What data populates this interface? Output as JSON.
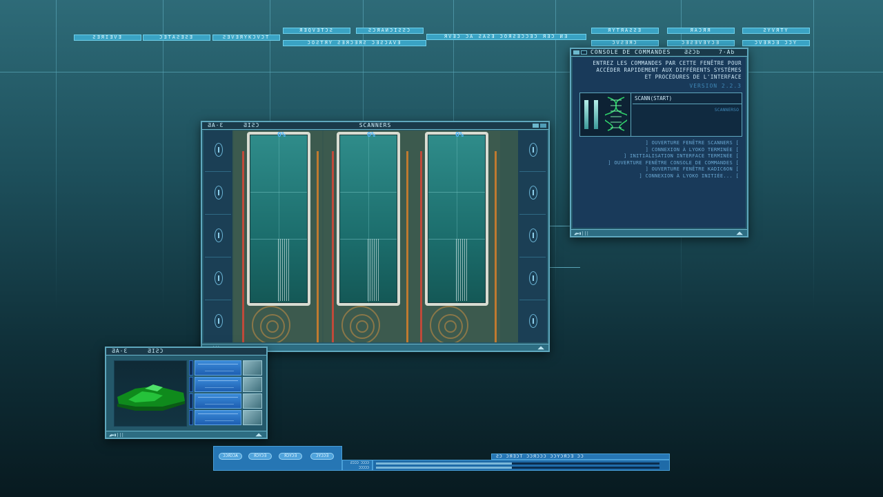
{
  "top_menu": {
    "row1": [
      {
        "label": "ƧƎЯIƎVƎ"
      },
      {
        "label": "ƆƎTAƧƎƧƎ"
      },
      {
        "label": "ƧƎVƎЯYKƆVƆT"
      },
      {
        "label": "ЯƎQVƎTƆƧ"
      },
      {
        "label": "ƧƆЯAИƆIƧƧƆ"
      },
      {
        "label": "ЯVƎƆ ƆA ƧAƧƎ ƆOЯƧƎƆƆƎƆ ЯƎƆ ИƎ"
      },
      {
        "label": "ЯYTЯAƧƧƎ"
      },
      {
        "label": "ЯAƆЯЯ"
      },
      {
        "label": "ƧYVЯTY"
      }
    ],
    "row2": [
      {
        "label": "ƆOƧTЯY  ƧƎЯƆƎЯƧ  ƆƎƧƆAVƎ"
      },
      {
        "label": "ƆVƧƎЯƆ"
      },
      {
        "label": "ƆƎƧƎVƎYƆƎ"
      },
      {
        "label": "ƆVƎЯƆƎ ƆƆY"
      }
    ]
  },
  "scanners": {
    "title": "SCANNERS",
    "glyphs_left": "ƋA·Ɛ",
    "glyphs_right": "ƋIƧƆ",
    "pods": [
      {
        "percent": "0%"
      },
      {
        "percent": "0%"
      },
      {
        "percent": "0%"
      }
    ],
    "footer_left": "◢▬▮|||",
    "footer_right": "◢◣"
  },
  "console": {
    "title": "CONSOLE DE COMMANDES",
    "glyphs_a": "ƋƧƆb",
    "glyphs_b": "7·Ab",
    "intro": [
      "ENTREZ LES COMMANDES PAR CETTE FENÊTRE POUR",
      "ACCÉDER RAPIDEMENT AUX DIFFÉRENTS SYSTÈMES",
      "ET PROCÉDURES DE L'INTERFACE"
    ],
    "version": "VERSION 2.2.3",
    "command": "SCANN(START)",
    "command_result": "SCANNERSO",
    "log": [
      "] OUVERTURE FENÊTRE SCANNERS [",
      "] CONNEXION À LYOKO TERMINÉE [",
      "] INITIALISATION INTERFACE TERMINÉE [",
      "] OUVERTURE FENÊTRE CONSOLE DE COMMANDES [",
      "] OUVERTURE FENÊTRE KADIC6ON [",
      "] CONNEXION À LYOKO INITIÉE... ["
    ],
    "footer_left": "◢▬▮|||",
    "footer_right": "◢◣"
  },
  "viewer": {
    "glyphs_left": "ƋA·Ɛ",
    "glyphs_right": "ƋIƧƆ",
    "footer_left": "◢▬▮|||",
    "footer_right": "◢◣",
    "rows": [
      {
        "label": ""
      },
      {
        "label": ""
      },
      {
        "label": ""
      },
      {
        "label": ""
      }
    ]
  },
  "taskbar": {
    "pills": [
      "ƆƆЯƆƆA",
      "ЯƆYƆƎ",
      "ЯƆYƆƎ",
      "ƆYƆƆƎ"
    ],
    "small_label": "ƧƆƆƆ ƆƆƆƆ ƆƆƆƆƆ",
    "status_menu": "ƧƆ ƆЯƎƆT  ƆƆЯƆƆƆ  ƆƆYƆЯƆƎ  ƆƆ",
    "progress": [
      0.48,
      0.48
    ]
  },
  "colors": {
    "accent": "#3aa3c4",
    "window_frame": "#5fa8be",
    "console_bg": "#193a5a",
    "pct": "#4fb8ff"
  }
}
